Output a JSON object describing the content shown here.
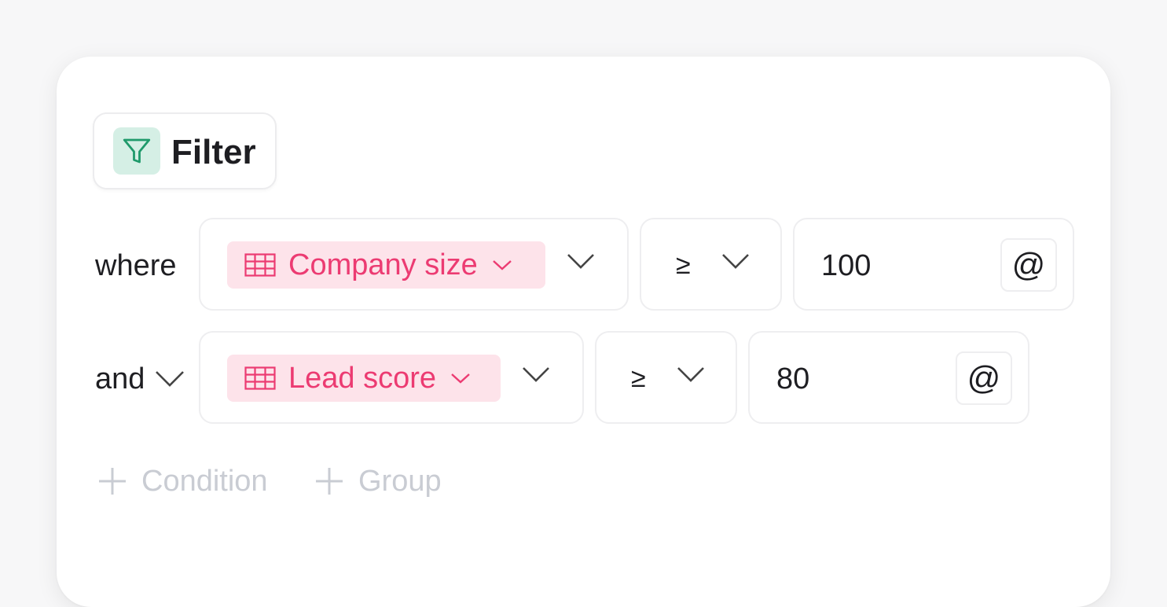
{
  "filter": {
    "title": "Filter",
    "icon": "funnel-icon",
    "accent": "#1f9a6b",
    "icon_bg": "#d5efe5"
  },
  "conditions": [
    {
      "conjunction": "where",
      "field": "Company size",
      "field_icon": "table-grid-icon",
      "operator": "≥",
      "value": "100",
      "value_button": "@"
    },
    {
      "conjunction": "and",
      "field": "Lead score",
      "field_icon": "table-grid-icon",
      "operator": "≥",
      "value": "80",
      "value_button": "@"
    }
  ],
  "actions": {
    "add_condition": "Condition",
    "add_group": "Group"
  },
  "colors": {
    "pill_bg": "#fde3ea",
    "pill_text": "#ec3b72",
    "muted": "#c9ccd3"
  }
}
